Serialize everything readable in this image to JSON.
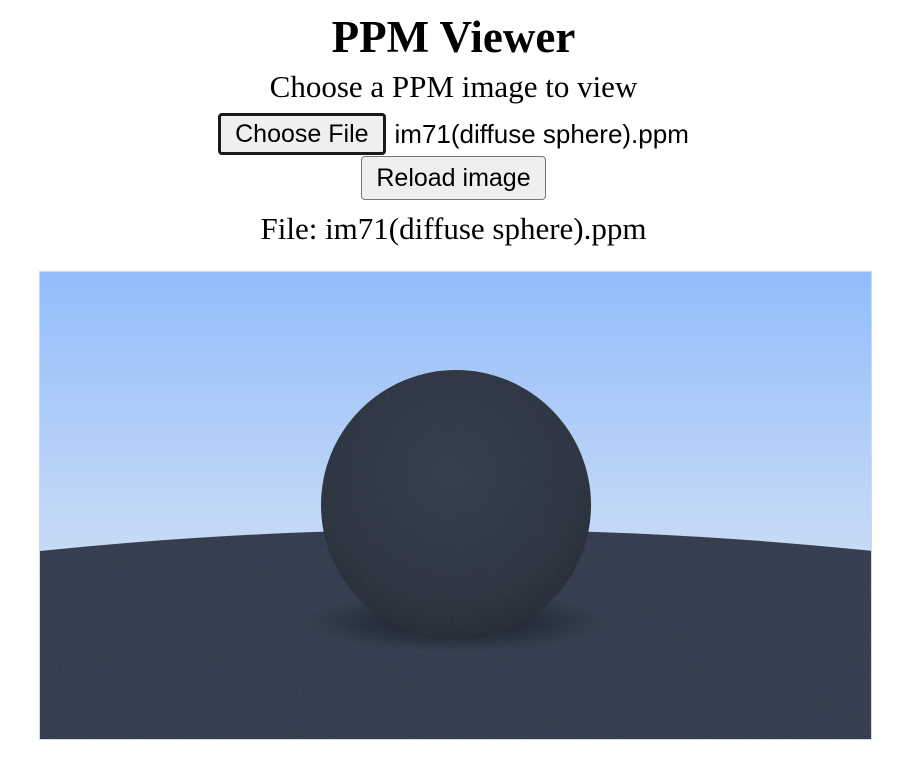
{
  "page": {
    "title": "PPM Viewer",
    "subtitle": "Choose a PPM image to view"
  },
  "file_input": {
    "button_label": "Choose File",
    "selected_file": "im71(diffuse sphere).ppm"
  },
  "reload": {
    "label": "Reload image"
  },
  "current_file": {
    "label": "File: im71(diffuse sphere).ppm"
  },
  "render": {
    "scene": "diffuse sphere on ground under blue sky",
    "colors": {
      "sky_top": "#92bdfb",
      "sky_bottom": "#c8dbf6",
      "ground": "#2a3546",
      "sphere": "#252e3c"
    }
  }
}
